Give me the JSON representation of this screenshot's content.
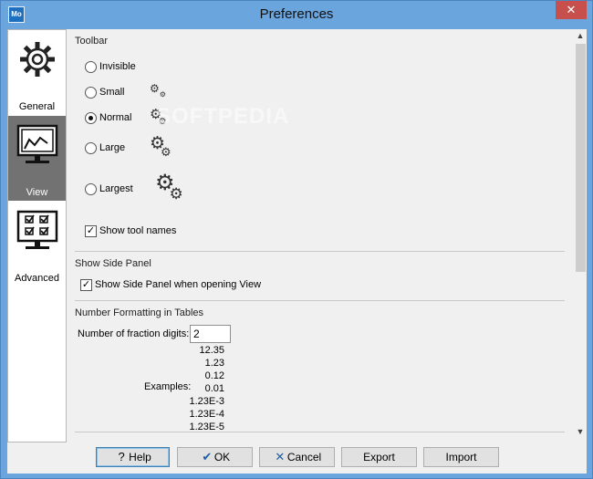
{
  "window": {
    "title": "Preferences",
    "app_icon_text": "Mo",
    "close_label": "✕"
  },
  "sidebar": {
    "items": [
      {
        "label": "General",
        "icon": "gear-icon"
      },
      {
        "label": "View",
        "icon": "monitor-chart-icon"
      },
      {
        "label": "Advanced",
        "icon": "checklist-monitor-icon"
      }
    ]
  },
  "toolbar_section": {
    "title": "Toolbar",
    "options": [
      {
        "label": "Invisible",
        "selected": false
      },
      {
        "label": "Small",
        "selected": false
      },
      {
        "label": "Normal",
        "selected": true
      },
      {
        "label": "Large",
        "selected": false
      },
      {
        "label": "Largest",
        "selected": false
      }
    ],
    "show_tool_names": {
      "label": "Show tool names",
      "checked": true
    }
  },
  "side_panel_section": {
    "title": "Show Side Panel",
    "checkbox": {
      "label": "Show Side Panel when opening View",
      "checked": true
    }
  },
  "number_section": {
    "title": "Number Formatting in Tables",
    "fraction_label": "Number of fraction digits:",
    "fraction_value": "2",
    "examples_label": "Examples:",
    "examples": [
      "12.35",
      "1.23",
      "0.12",
      "0.01",
      "1.23E-3",
      "1.23E-4",
      "1.23E-5"
    ]
  },
  "buttons": {
    "help": "Help",
    "ok": "OK",
    "cancel": "Cancel",
    "export": "Export",
    "import": "Import"
  },
  "watermark": "SOFTPEDIA"
}
